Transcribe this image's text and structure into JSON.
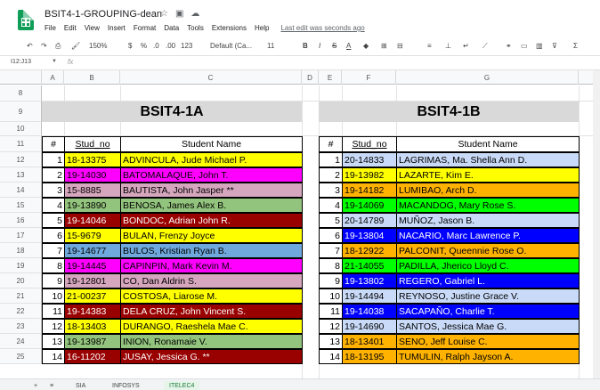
{
  "app": {
    "doc_title": "BSIT4-1-GROUPING-dean",
    "menu": [
      "File",
      "Edit",
      "View",
      "Insert",
      "Format",
      "Data",
      "Tools",
      "Extensions",
      "Help"
    ],
    "last_edit": "Last edit was seconds ago"
  },
  "toolbar": {
    "zoom": "150%",
    "currency": "$",
    "percent": "%",
    "dec_less": ".0",
    "dec_more": ".00",
    "more_formats": "123",
    "font": "Default (Ca...",
    "font_size": "11",
    "bold": "B",
    "italic": "I",
    "strike": "S",
    "text_color": "A"
  },
  "formula_bar": {
    "name_box": "I12:J13",
    "fx": "fx"
  },
  "columns": [
    "A",
    "B",
    "C",
    "D",
    "E",
    "F",
    "G"
  ],
  "rows": [
    "8",
    "9",
    "10",
    "11",
    "12",
    "13",
    "14",
    "15",
    "16",
    "17",
    "18",
    "19",
    "20",
    "21",
    "22",
    "23",
    "24",
    "25"
  ],
  "left": {
    "title": "BSIT4-1A",
    "headers": {
      "num": "#",
      "stud_no": "Stud_no",
      "name": "Student Name"
    },
    "students": [
      {
        "n": "1",
        "id": "18-13375",
        "name": "ADVINCULA, Jude Michael P.",
        "color": "#ffff00",
        "text": "#000000"
      },
      {
        "n": "2",
        "id": "19-14030",
        "name": "BATOMALAQUE, John T.",
        "color": "#ff00ff",
        "text": "#000000"
      },
      {
        "n": "3",
        "id": "15-8885",
        "name": "BAUTISTA, John Jasper **",
        "color": "#d5a6bd",
        "text": "#000000"
      },
      {
        "n": "4",
        "id": "19-13890",
        "name": "BENOSA, James Alex B.",
        "color": "#93c47d",
        "text": "#000000"
      },
      {
        "n": "5",
        "id": "19-14046",
        "name": "BONDOC, Adrian John R.",
        "color": "#990000",
        "text": "#ffffff"
      },
      {
        "n": "6",
        "id": "15-9679",
        "name": "BULAN, Frenzy Joyce",
        "color": "#ffff00",
        "text": "#000000"
      },
      {
        "n": "7",
        "id": "19-14677",
        "name": "BULOS, Kristian Ryan B.",
        "color": "#6fa8dc",
        "text": "#000000"
      },
      {
        "n": "8",
        "id": "19-14445",
        "name": "CAPINPIN, Mark Kevin M.",
        "color": "#ff00ff",
        "text": "#000000"
      },
      {
        "n": "9",
        "id": "19-12801",
        "name": "CO, Dan Aldrin S.",
        "color": "#d5a6bd",
        "text": "#000000"
      },
      {
        "n": "10",
        "id": "21-00237",
        "name": "COSTOSA, Liarose M.",
        "color": "#ffff00",
        "text": "#000000"
      },
      {
        "n": "11",
        "id": "19-14383",
        "name": "DELA CRUZ, John Vincent S.",
        "color": "#990000",
        "text": "#ffffff"
      },
      {
        "n": "12",
        "id": "18-13403",
        "name": "DURANGO, Raeshela Mae C.",
        "color": "#ffff00",
        "text": "#000000"
      },
      {
        "n": "13",
        "id": "19-13987",
        "name": "INION, Ronamaie V.",
        "color": "#93c47d",
        "text": "#000000"
      },
      {
        "n": "14",
        "id": "16-11202",
        "name": "JUSAY, Jessica G. **",
        "color": "#990000",
        "text": "#ffffff"
      }
    ]
  },
  "right": {
    "title": "BSIT4-1B",
    "headers": {
      "num": "#",
      "stud_no": "Stud_no",
      "name": "Student Name"
    },
    "students": [
      {
        "n": "1",
        "id": "20-14833",
        "name": "LAGRIMAS, Ma. Shella Ann D.",
        "color": "#c9daf8",
        "text": "#000000"
      },
      {
        "n": "2",
        "id": "19-13982",
        "name": "LAZARTE, Kim E.",
        "color": "#ffff00",
        "text": "#000000"
      },
      {
        "n": "3",
        "id": "19-14182",
        "name": "LUMIBAO, Arch D.",
        "color": "#ffb300",
        "text": "#000000"
      },
      {
        "n": "4",
        "id": "19-14069",
        "name": "MACANDOG, Mary Rose S.",
        "color": "#00ff00",
        "text": "#000000"
      },
      {
        "n": "5",
        "id": "20-14789",
        "name": "MUÑOZ, Jason B.",
        "color": "#c9daf8",
        "text": "#000000"
      },
      {
        "n": "6",
        "id": "19-13804",
        "name": "NACARIO, Marc Lawrence P.",
        "color": "#0000ff",
        "text": "#ffffff"
      },
      {
        "n": "7",
        "id": "18-12922",
        "name": "PALCONIT, Queennie Rose O.",
        "color": "#ffb300",
        "text": "#000000"
      },
      {
        "n": "8",
        "id": "21-14055",
        "name": "PADILLA, Jherico Lloyd C.",
        "color": "#00ff00",
        "text": "#000000"
      },
      {
        "n": "9",
        "id": "19-13802",
        "name": "REGERO, Gabriel L.",
        "color": "#0000ff",
        "text": "#ffffff"
      },
      {
        "n": "10",
        "id": "19-14494",
        "name": "REYNOSO, Justine Grace V.",
        "color": "#c9daf8",
        "text": "#000000"
      },
      {
        "n": "11",
        "id": "19-14038",
        "name": "SACAPAÑO, Charlie T.",
        "color": "#0000ff",
        "text": "#ffffff"
      },
      {
        "n": "12",
        "id": "19-14690",
        "name": "SANTOS, Jessica Mae G.",
        "color": "#c9daf8",
        "text": "#000000"
      },
      {
        "n": "13",
        "id": "18-13401",
        "name": "SENO, Jeff Louise C.",
        "color": "#ffb300",
        "text": "#000000"
      },
      {
        "n": "14",
        "id": "18-13195",
        "name": "TUMULIN, Ralph Jayson A.",
        "color": "#ffb300",
        "text": "#000000"
      }
    ]
  },
  "sheet_tabs": [
    "SIA",
    "INFOSYS",
    "ITELEC4"
  ]
}
